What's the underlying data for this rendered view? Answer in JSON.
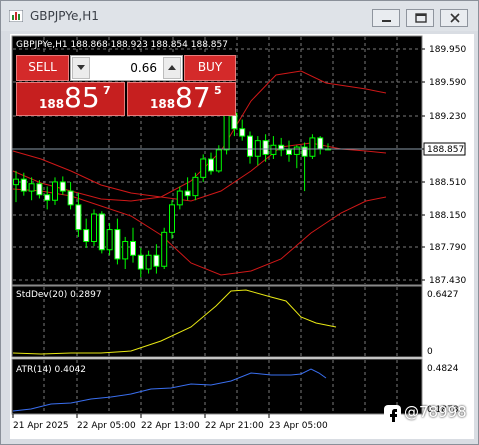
{
  "window": {
    "title": "GBPJPYe,H1",
    "minimize_label": "minimize",
    "restore_label": "restore",
    "close_label": "close"
  },
  "chart": {
    "header": "GBPJPYe,H1  188.868 188.923 188.854 188.857",
    "background": "#000000",
    "bull_color": "#00ff00",
    "bear_color": "#ffffff",
    "current_price_label": "188.857",
    "price_ticks": [
      "189.950",
      "189.590",
      "189.230",
      "188.870",
      "188.510",
      "188.150",
      "187.790",
      "187.430"
    ],
    "time_ticks": [
      "21 Apr 2025",
      "22 Apr 05:00",
      "22 Apr 13:00",
      "22 Apr 21:00",
      "23 Apr 05:00"
    ],
    "bands_color": "#d01818"
  },
  "trade_panel": {
    "sell_label": "SELL",
    "buy_label": "BUY",
    "lot_value": "0.66",
    "sell_price_prefix": "188",
    "sell_price_big": "85",
    "sell_price_sup": "7",
    "buy_price_prefix": "188",
    "buy_price_big": "87",
    "buy_price_sup": "5"
  },
  "stddev": {
    "label": "StdDev(20) 0.2897",
    "max_tick": "0.6427",
    "min_tick": "0",
    "color": "#e8e814"
  },
  "atr": {
    "label": "ATR(14) 0.4042",
    "max_tick": "0.4824",
    "min_tick": "0.1878",
    "color": "#3a6ff0"
  },
  "watermark": {
    "text": "@78998"
  }
}
